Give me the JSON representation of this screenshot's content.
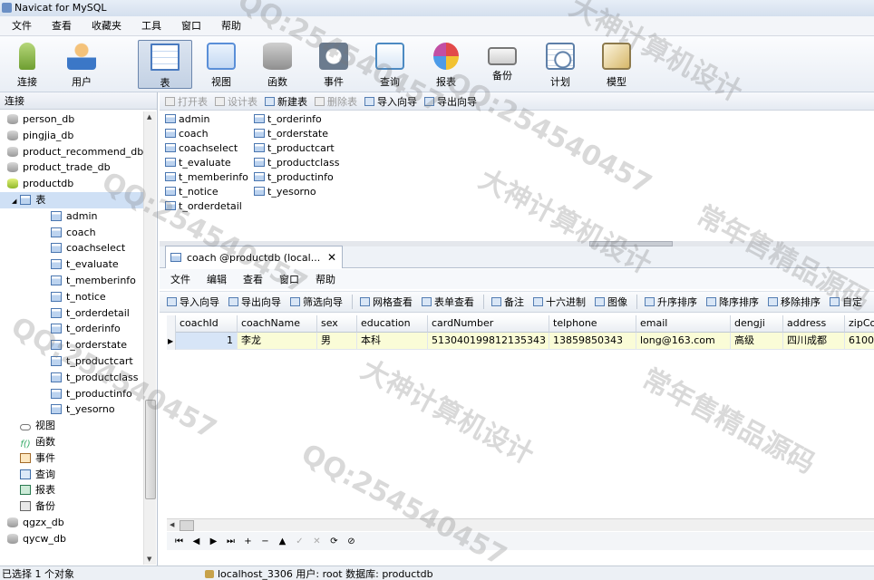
{
  "window": {
    "title": "Navicat for MySQL"
  },
  "menubar": [
    "文件",
    "查看",
    "收藏夹",
    "工具",
    "窗口",
    "帮助"
  ],
  "toolbar": [
    {
      "label": "连接",
      "icon": "connection-icon",
      "color": "#7fae3f"
    },
    {
      "label": "用户",
      "icon": "user-icon",
      "color": "#3b77c7"
    },
    {
      "label": "表",
      "icon": "table-icon",
      "color": "#4a7bc0",
      "active": true
    },
    {
      "label": "视图",
      "icon": "view-icon",
      "color": "#5a8fd8"
    },
    {
      "label": "函数",
      "icon": "function-icon",
      "color": "#d98c2e"
    },
    {
      "label": "事件",
      "icon": "event-icon",
      "color": "#8c8c8c"
    },
    {
      "label": "查询",
      "icon": "query-icon",
      "color": "#4c8ac2"
    },
    {
      "label": "报表",
      "icon": "report-icon",
      "color": "#c24fa4"
    },
    {
      "label": "备份",
      "icon": "backup-icon",
      "color": "#777777"
    },
    {
      "label": "计划",
      "icon": "schedule-icon",
      "color": "#5d7fa8"
    },
    {
      "label": "模型",
      "icon": "model-icon",
      "color": "#c59a3a"
    }
  ],
  "sidebar": {
    "header": "连接",
    "items": [
      {
        "label": "person_db",
        "type": "db",
        "indent": 0
      },
      {
        "label": "pingjia_db",
        "type": "db",
        "indent": 0
      },
      {
        "label": "product_recommend_db",
        "type": "db",
        "indent": 0
      },
      {
        "label": "product_trade_db",
        "type": "db",
        "indent": 0
      },
      {
        "label": "productdb",
        "type": "dbo",
        "indent": 0
      },
      {
        "label": "表",
        "type": "tbl",
        "indent": 1,
        "expanded": true
      },
      {
        "label": "admin",
        "type": "tbl",
        "indent": 2
      },
      {
        "label": "coach",
        "type": "tbl",
        "indent": 2
      },
      {
        "label": "coachselect",
        "type": "tbl",
        "indent": 2
      },
      {
        "label": "t_evaluate",
        "type": "tbl",
        "indent": 2
      },
      {
        "label": "t_memberinfo",
        "type": "tbl",
        "indent": 2
      },
      {
        "label": "t_notice",
        "type": "tbl",
        "indent": 2
      },
      {
        "label": "t_orderdetail",
        "type": "tbl",
        "indent": 2
      },
      {
        "label": "t_orderinfo",
        "type": "tbl",
        "indent": 2
      },
      {
        "label": "t_orderstate",
        "type": "tbl",
        "indent": 2
      },
      {
        "label": "t_productcart",
        "type": "tbl",
        "indent": 2
      },
      {
        "label": "t_productclass",
        "type": "tbl",
        "indent": 2
      },
      {
        "label": "t_productinfo",
        "type": "tbl",
        "indent": 2
      },
      {
        "label": "t_yesorno",
        "type": "tbl",
        "indent": 2
      },
      {
        "label": "视图",
        "type": "view",
        "indent": 1
      },
      {
        "label": "函数",
        "type": "fn",
        "indent": 1
      },
      {
        "label": "事件",
        "type": "evt",
        "indent": 1
      },
      {
        "label": "查询",
        "type": "qry",
        "indent": 1
      },
      {
        "label": "报表",
        "type": "rpt",
        "indent": 1
      },
      {
        "label": "备份",
        "type": "bak",
        "indent": 1
      },
      {
        "label": "qgzx_db",
        "type": "db",
        "indent": 0
      },
      {
        "label": "qycw_db",
        "type": "db",
        "indent": 0
      }
    ]
  },
  "object_toolbar": [
    {
      "label": "打开表",
      "enabled": false
    },
    {
      "label": "设计表",
      "enabled": false
    },
    {
      "label": "新建表",
      "enabled": true
    },
    {
      "label": "删除表",
      "enabled": false
    },
    {
      "label": "导入向导",
      "enabled": true
    },
    {
      "label": "导出向导",
      "enabled": true
    }
  ],
  "object_list": {
    "col1": [
      "admin",
      "coach",
      "coachselect",
      "t_evaluate",
      "t_memberinfo",
      "t_notice",
      "t_orderdetail"
    ],
    "col2": [
      "t_orderinfo",
      "t_orderstate",
      "t_productcart",
      "t_productclass",
      "t_productinfo",
      "t_yesorno"
    ]
  },
  "doc_tab": {
    "title": "coach @productdb (local...",
    "close": "✕"
  },
  "doc_menu": [
    "文件",
    "编辑",
    "查看",
    "窗口",
    "帮助"
  ],
  "doc_toolbar": [
    "导入向导",
    "导出向导",
    "筛选向导",
    "网格查看",
    "表单查看",
    "备注",
    "十六进制",
    "图像",
    "升序排序",
    "降序排序",
    "移除排序",
    "自定"
  ],
  "grid": {
    "columns": [
      "coachId",
      "coachName",
      "sex",
      "education",
      "cardNumber",
      "telphone",
      "email",
      "dengji",
      "address",
      "zipCo"
    ],
    "rows": [
      [
        "1",
        "李龙",
        "男",
        "本科",
        "513040199812135343",
        "13859850343",
        "long@163.com",
        "高级",
        "四川成都",
        "6100"
      ]
    ]
  },
  "nav_buttons": [
    "⏮",
    "◀",
    "▶",
    "⏭",
    "+",
    "−",
    "▲",
    "✓",
    "✕",
    "⟳",
    "⊘"
  ],
  "status": {
    "left": "已选择 1 个对象",
    "right": "localhost_3306   用户: root   数据库: productdb"
  },
  "watermarks": [
    "QQ:254540457",
    "大神计算机设计",
    "常年售精品源码"
  ]
}
